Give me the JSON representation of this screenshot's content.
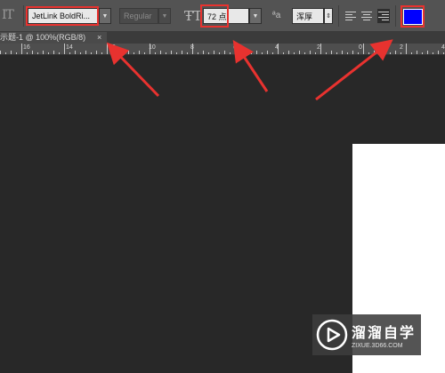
{
  "options_bar": {
    "font_family": "JetLink BoldRi...",
    "font_style": "Regular",
    "font_size": "72 点",
    "anti_alias": "浑厚",
    "text_color": "#0000ff"
  },
  "document_tab": {
    "title": "示题-1 @ 100%(RGB/8)",
    "close": "×"
  },
  "ruler": {
    "labels": [
      "16",
      "14",
      "12",
      "10",
      "8",
      "6",
      "4",
      "2",
      "0",
      "2",
      "4"
    ]
  },
  "watermark": {
    "name": "溜溜自学",
    "url": "ZIXUE.3D66.COM"
  },
  "colors": {
    "options_bar_bg": "#535353",
    "workspace_bg": "#282828",
    "highlight": "#e8322f",
    "canvas": "#ffffff"
  }
}
